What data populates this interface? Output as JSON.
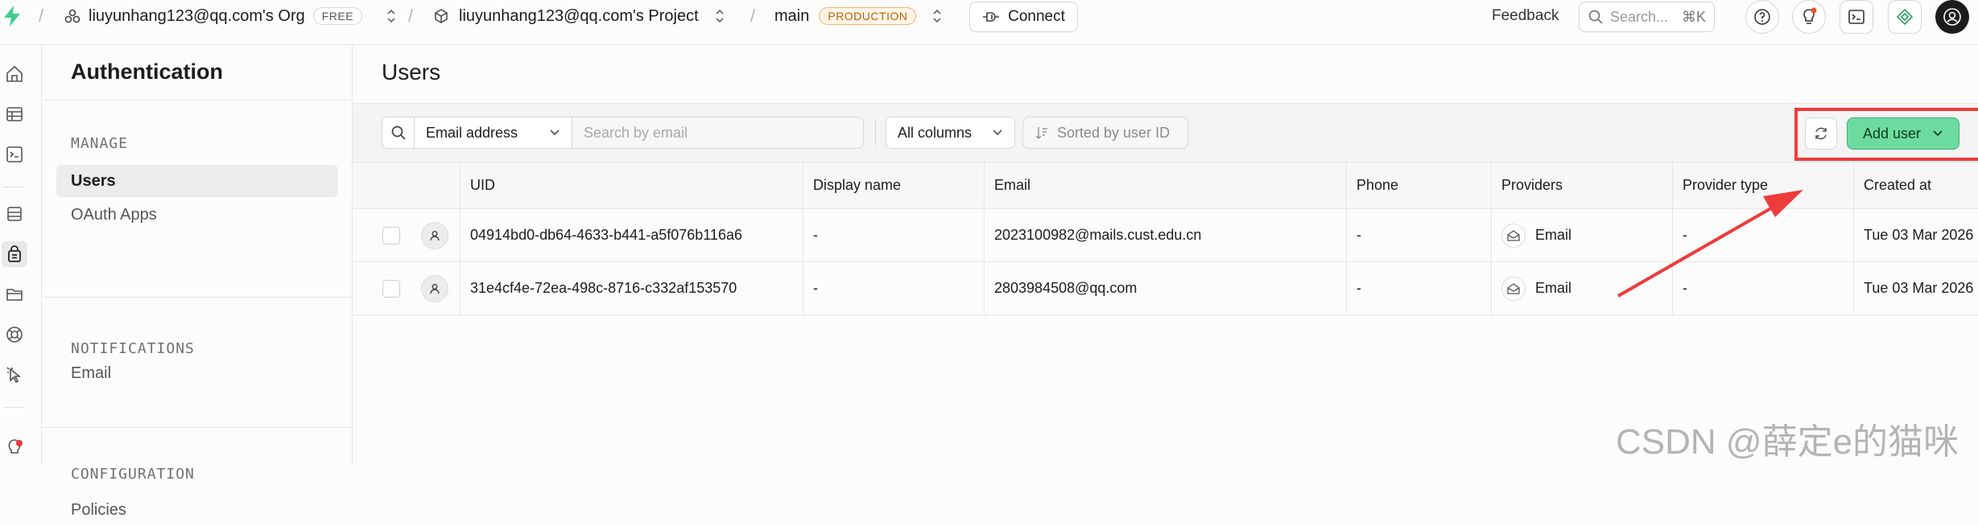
{
  "topbar": {
    "org_name": "liuyunhang123@qq.com's Org",
    "org_plan": "FREE",
    "project_name": "liuyunhang123@qq.com's Project",
    "branch_name": "main",
    "branch_env": "PRODUCTION",
    "connect_label": "Connect",
    "feedback_label": "Feedback",
    "search_placeholder": "Search...",
    "search_shortcut": "⌘K"
  },
  "sidebar": {
    "title": "Authentication",
    "sections": [
      {
        "heading": "MANAGE",
        "items": [
          {
            "label": "Users",
            "active": true
          },
          {
            "label": "OAuth Apps",
            "active": false
          }
        ]
      },
      {
        "heading": "NOTIFICATIONS",
        "items": [
          {
            "label": "Email",
            "active": false
          }
        ]
      },
      {
        "heading": "CONFIGURATION",
        "items": [
          {
            "label": "Policies",
            "active": false
          }
        ]
      }
    ]
  },
  "main": {
    "title": "Users",
    "toolbar": {
      "filter_field": "Email address",
      "search_placeholder": "Search by email",
      "columns_label": "All columns",
      "sort_label": "Sorted by user ID",
      "add_user_label": "Add user"
    },
    "table": {
      "columns": [
        "UID",
        "Display name",
        "Email",
        "Phone",
        "Providers",
        "Provider type",
        "Created at"
      ],
      "rows": [
        {
          "uid": "04914bd0-db64-4633-b441-a5f076b116a6",
          "display_name": "-",
          "email": "2023100982@mails.cust.edu.cn",
          "phone": "-",
          "provider": "Email",
          "provider_type": "-",
          "created_at": "Tue 03 Mar 2026"
        },
        {
          "uid": "31e4cf4e-72ea-498c-8716-c332af153570",
          "display_name": "-",
          "email": "2803984508@qq.com",
          "phone": "-",
          "provider": "Email",
          "provider_type": "-",
          "created_at": "Tue 03 Mar 2026"
        }
      ]
    }
  },
  "watermark": "CSDN @薛定e的猫咪",
  "colors": {
    "brand": "#3ecf8e",
    "add_button": "#6ddba0",
    "annotation": "#ee3b3b",
    "production_badge": "#b8650a"
  }
}
